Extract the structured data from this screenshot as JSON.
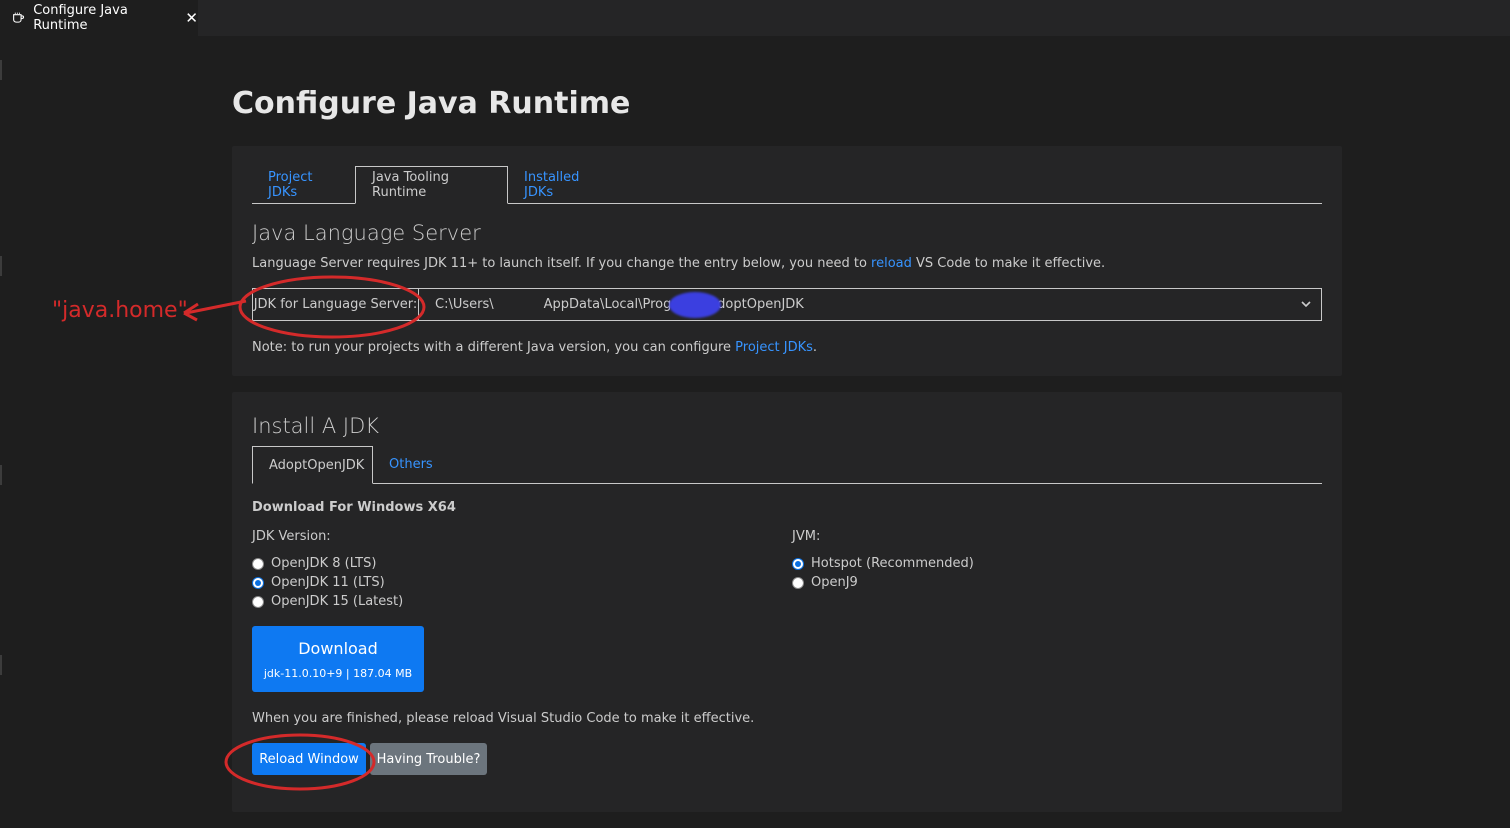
{
  "editor_tab": {
    "title": "Configure Java Runtime",
    "close": "✕"
  },
  "page": {
    "title": "Configure Java Runtime"
  },
  "tooling_panel": {
    "tabs": [
      {
        "label": "Project JDKs",
        "active": false
      },
      {
        "label": "Java Tooling Runtime",
        "active": true
      },
      {
        "label": "Installed JDKs",
        "active": false
      }
    ],
    "section_title": "Java Language Server",
    "description_before": "Language Server requires JDK 11+ to launch itself. If you change the entry below, you need to ",
    "description_link": "reload",
    "description_after": " VS Code to make it effective.",
    "jdk_label": "JDK for Language Server:",
    "jdk_value_prefix": "C:\\Users\\",
    "jdk_value_suffix": "AppData\\Local\\Programs\\AdoptOpenJDK",
    "note_before": "Note: to run your projects with a different Java version, you can configure ",
    "note_link": "Project JDKs",
    "note_after": "."
  },
  "install_panel": {
    "section_title": "Install A JDK",
    "tabs": [
      {
        "label": "AdoptOpenJDK",
        "active": true
      },
      {
        "label": "Others",
        "active": false
      }
    ],
    "download_heading": "Download For Windows X64",
    "jdk_version_label": "JDK Version:",
    "jdk_versions": [
      {
        "label": "OpenJDK 8 (LTS)",
        "checked": false
      },
      {
        "label": "OpenJDK 11 (LTS)",
        "checked": true
      },
      {
        "label": "OpenJDK 15 (Latest)",
        "checked": false
      }
    ],
    "jvm_label": "JVM:",
    "jvms": [
      {
        "label": "Hotspot (Recommended)",
        "checked": true
      },
      {
        "label": "OpenJ9",
        "checked": false
      }
    ],
    "download_button": {
      "label": "Download",
      "sublabel": "jdk-11.0.10+9 | 187.04 MB"
    },
    "finished_text": "When you are finished, please reload Visual Studio Code to make it effective.",
    "reload_button": "Reload Window",
    "trouble_button": "Having Trouble?"
  },
  "annotation": {
    "label": "\"java.home\"",
    "color": "#d42a2a"
  },
  "colors": {
    "background": "#1e1e1e",
    "panel": "#252526",
    "link": "#3794ff",
    "primary_button": "#0e79f2",
    "secondary_button": "#6c757d"
  }
}
